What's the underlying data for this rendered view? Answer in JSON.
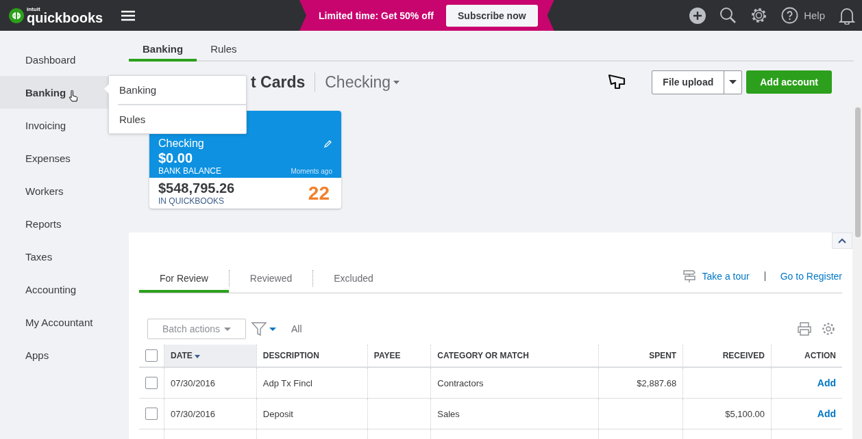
{
  "top_bar": {
    "logo_small": "intuit",
    "logo": "quickbooks",
    "promo_text": "Limited time: Get 50% off",
    "promo_button": "Subscribe now",
    "help": "Help"
  },
  "sidebar": {
    "items": [
      {
        "label": "Dashboard",
        "selected": false
      },
      {
        "label": "Banking",
        "selected": true
      },
      {
        "label": "Invoicing",
        "selected": false
      },
      {
        "label": "Expenses",
        "selected": false
      },
      {
        "label": "Workers",
        "selected": false
      },
      {
        "label": "Reports",
        "selected": false
      },
      {
        "label": "Taxes",
        "selected": false
      },
      {
        "label": "Accounting",
        "selected": false
      },
      {
        "label": "My Accountant",
        "selected": false
      },
      {
        "label": "Apps",
        "selected": false
      }
    ]
  },
  "flyout_menu": [
    "Banking",
    "Rules"
  ],
  "tabs": [
    {
      "label": "Banking",
      "selected": true
    },
    {
      "label": "Rules",
      "selected": false
    }
  ],
  "header": {
    "title": "t Cards",
    "account": "Checking",
    "file_upload": "File upload",
    "add_account": "Add account"
  },
  "account_card": {
    "name": "Checking",
    "bank_balance": "$0.00",
    "bank_label": "BANK BALANCE",
    "updated": "Moments ago",
    "qb_balance": "$548,795.26",
    "qb_label": "IN QUICKBOOKS",
    "count": "22"
  },
  "review_tabs": [
    {
      "label": "For Review",
      "selected": true
    },
    {
      "label": "Reviewed",
      "selected": false
    },
    {
      "label": "Excluded",
      "selected": false
    }
  ],
  "links": {
    "tour": "Take a tour",
    "register": "Go to Register"
  },
  "toolbar": {
    "batch": "Batch actions",
    "filter": "All"
  },
  "table": {
    "all_checked": false,
    "columns": [
      {
        "label": "DATE",
        "sorted": true
      },
      {
        "label": "DESCRIPTION",
        "sorted": false
      },
      {
        "label": "PAYEE",
        "sorted": false
      },
      {
        "label": "CATEGORY OR MATCH",
        "sorted": false
      },
      {
        "label": "SPENT",
        "sorted": false
      },
      {
        "label": "RECEIVED",
        "sorted": false
      },
      {
        "label": "ACTION",
        "sorted": false
      }
    ],
    "rows": [
      {
        "checked": false,
        "cells": [
          "07/30/2016",
          "Adp Tx Fincl",
          "",
          "Contractors",
          "$2,887.68",
          "",
          "Add"
        ]
      },
      {
        "checked": false,
        "cells": [
          "07/30/2016",
          "Deposit",
          "",
          "Sales",
          "",
          "$5,100.00",
          "Add"
        ]
      }
    ]
  }
}
